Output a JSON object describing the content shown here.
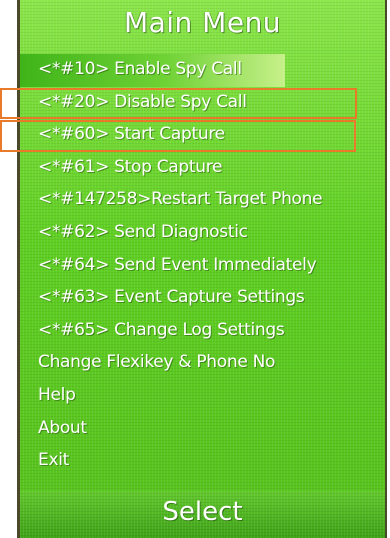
{
  "title": "Main Menu",
  "menu": {
    "items": [
      {
        "label": "<*#10> Enable Spy Call",
        "selected": true
      },
      {
        "label": "<*#20> Disable Spy Call",
        "highlighted": true
      },
      {
        "label": "<*#60> Start Capture",
        "highlighted": true
      },
      {
        "label": "<*#61> Stop Capture"
      },
      {
        "label": "<*#147258>Restart Target Phone"
      },
      {
        "label": "<*#62> Send Diagnostic"
      },
      {
        "label": "<*#64> Send Event Immediately"
      },
      {
        "label": "<*#63> Event Capture Settings"
      },
      {
        "label": "<*#65> Change Log Settings"
      },
      {
        "label": "Change Flexikey & Phone No"
      },
      {
        "label": "Help"
      },
      {
        "label": "About"
      },
      {
        "label": "Exit"
      }
    ]
  },
  "softkey": {
    "center_label": "Select"
  },
  "colors": {
    "background": "#66d42a",
    "selected_gradient_end": "#c7f08a",
    "annotation_box": "#e87a2a",
    "text": "#ffffff"
  }
}
